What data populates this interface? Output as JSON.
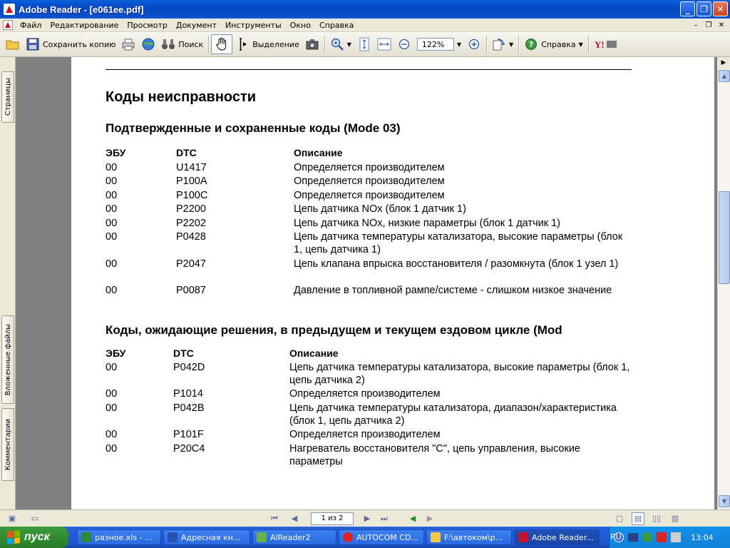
{
  "window": {
    "title": "Adobe Reader - [e061ee.pdf]"
  },
  "menu": [
    "Файл",
    "Редактирование",
    "Просмотр",
    "Документ",
    "Инструменты",
    "Окно",
    "Справка"
  ],
  "toolbar": {
    "save_copy": "Сохранить копию",
    "search": "Поиск",
    "select": "Выделение",
    "zoom": "122%",
    "help": "Справка"
  },
  "left_tabs": {
    "pages": "Страницы",
    "attachments": "Вложенные файлы",
    "comments": "Комментарии"
  },
  "doc": {
    "title": "Коды неисправности",
    "section1": {
      "heading": "Подтвержденные и сохраненные коды (Mode 03)",
      "cols": [
        "ЭБУ",
        "DTC",
        "Описание"
      ],
      "rows": [
        {
          "ecu": "00",
          "dtc": "U1417",
          "desc": "Определяется производителем"
        },
        {
          "ecu": "00",
          "dtc": "P100A",
          "desc": "Определяется производителем"
        },
        {
          "ecu": "00",
          "dtc": "P100C",
          "desc": "Определяется производителем"
        },
        {
          "ecu": "00",
          "dtc": "P2200",
          "desc": "Цепь датчика NOx (блок 1 датчик 1)"
        },
        {
          "ecu": "00",
          "dtc": "P2202",
          "desc": "Цепь датчика NOx, низкие параметры (блок 1 датчик 1)"
        },
        {
          "ecu": "00",
          "dtc": "P0428",
          "desc": "Цепь датчика температуры катализатора, высокие параметры (блок 1, цепь датчика 1)"
        },
        {
          "ecu": "00",
          "dtc": "P2047",
          "desc": "Цепь клапана впрыска восстановителя / разомкнута (блок 1 узел 1)"
        },
        {
          "ecu": "00",
          "dtc": "P0087",
          "desc": "Давление в топливной рампе/системе - слишком низкое значение"
        }
      ]
    },
    "section2": {
      "heading": "Коды, ожидающие решения, в предыдущем и текущем ездовом цикле (Mod",
      "cols": [
        "ЭБУ",
        "DTC",
        "Описание"
      ],
      "rows": [
        {
          "ecu": "00",
          "dtc": "P042D",
          "desc": "Цепь датчика температуры катализатора, высокие параметры (блок 1, цепь датчика 2)"
        },
        {
          "ecu": "00",
          "dtc": "P1014",
          "desc": "Определяется производителем"
        },
        {
          "ecu": "00",
          "dtc": "P042B",
          "desc": "Цепь датчика температуры катализатора, диапазон/характеристика (блок 1, цепь датчика 2)"
        },
        {
          "ecu": "00",
          "dtc": "P101F",
          "desc": "Определяется производителем"
        },
        {
          "ecu": "00",
          "dtc": "P20C4",
          "desc": "Нагреватель восстановителя \"С\", цепь управления, высокие параметры"
        }
      ]
    }
  },
  "status": {
    "page": "1 из 2"
  },
  "taskbar": {
    "start": "пуск",
    "tasks": [
      "разное.xls - ...",
      "Адресная кн...",
      "AlReader2",
      "AUTOCOM CD...",
      "F:\\автоком\\р...",
      "Adobe Reader..."
    ],
    "lang": "RU",
    "clock": "13:04"
  }
}
